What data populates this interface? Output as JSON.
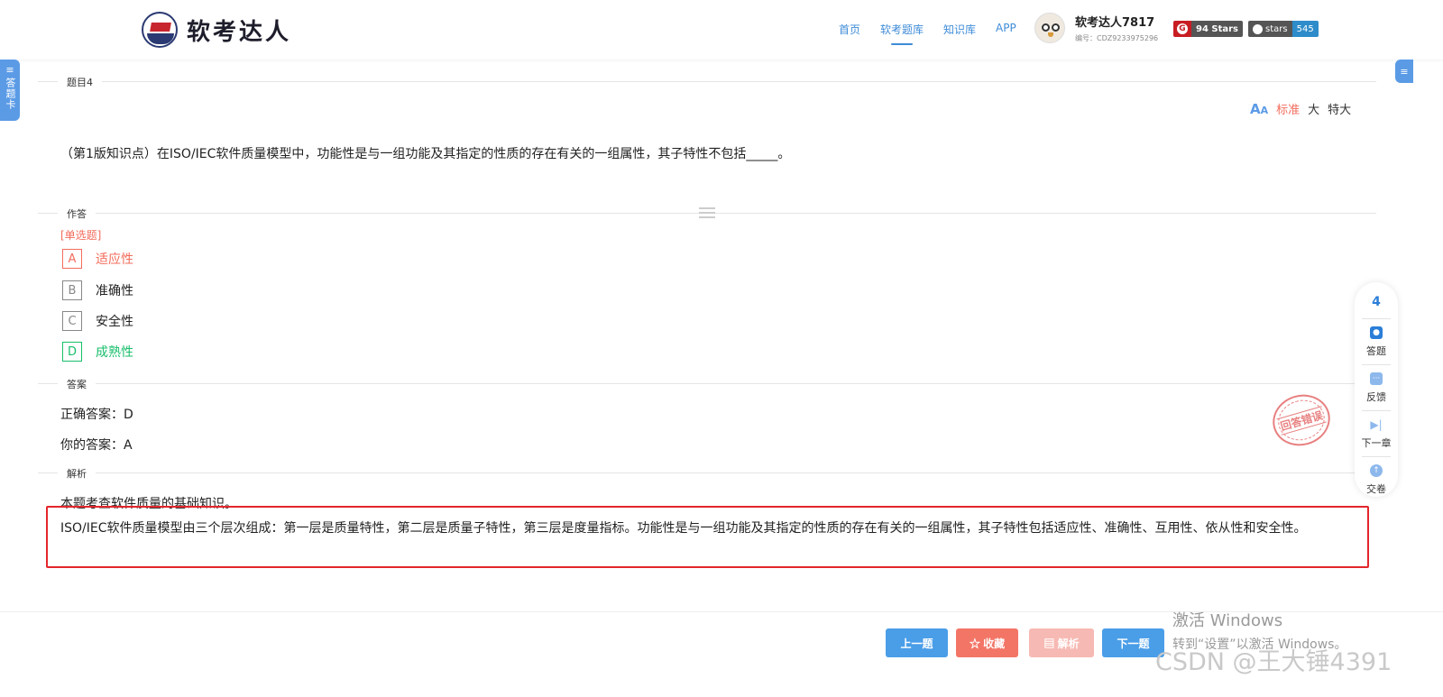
{
  "header": {
    "logo_text": "软考达人",
    "nav": [
      "首页",
      "软考题库",
      "知识库",
      "APP"
    ],
    "active_nav": 1,
    "user": {
      "name": "软考达人7817",
      "id": "编号：CDZ9233975296"
    },
    "badges": {
      "gitee": {
        "value": "94 Stars"
      },
      "github": {
        "label": "stars",
        "value": "545"
      }
    }
  },
  "side": {
    "answer_card": "答题卡",
    "menu_icon": "≡"
  },
  "question": {
    "section_title": "题目4",
    "font_sizes": {
      "standard": "标准",
      "large": "大",
      "xlarge": "特大"
    },
    "text": "（第1版知识点）在ISO/IEC软件质量模型中，功能性是与一组功能及其指定的性质的存在有关的一组属性，其子特性不包括_____。"
  },
  "answer_section": {
    "section_title": "作答",
    "type": "[单选题]",
    "options": [
      {
        "letter": "A",
        "label": "适应性"
      },
      {
        "letter": "B",
        "label": "准确性"
      },
      {
        "letter": "C",
        "label": "安全性"
      },
      {
        "letter": "D",
        "label": "成熟性"
      }
    ]
  },
  "result": {
    "section_title": "答案",
    "correct": "正确答案：D",
    "yours": "你的答案：A",
    "stamp": "回答错误"
  },
  "analysis": {
    "section_title": "解析",
    "line1": "本题考查软件质量的基础知识。",
    "body": "ISO/IEC软件质量模型由三个层次组成：第一层是质量特性，第二层是质量子特性，第三层是度量指标。功能性是与一组功能及其指定的性质的存在有关的一组属性，其子特性包括适应性、准确性、互用性、依从性和安全性。"
  },
  "float_panel": {
    "number": "4",
    "items": [
      "答题",
      "反馈",
      "下一章",
      "交卷"
    ]
  },
  "buttons": {
    "prev": "上一题",
    "favorite": "☆ 收藏",
    "analysis": "▤ 解析",
    "next": "下一题"
  },
  "watermark": {
    "line1": "激活 Windows",
    "line2": "转到“设置”以激活 Windows。",
    "csdn": "CSDN @王大锤4391"
  },
  "colors": {
    "accent": "#3f8cd8",
    "wrong": "#f36c5c",
    "correct": "#19be6b",
    "highlight_border": "#e3262b"
  }
}
